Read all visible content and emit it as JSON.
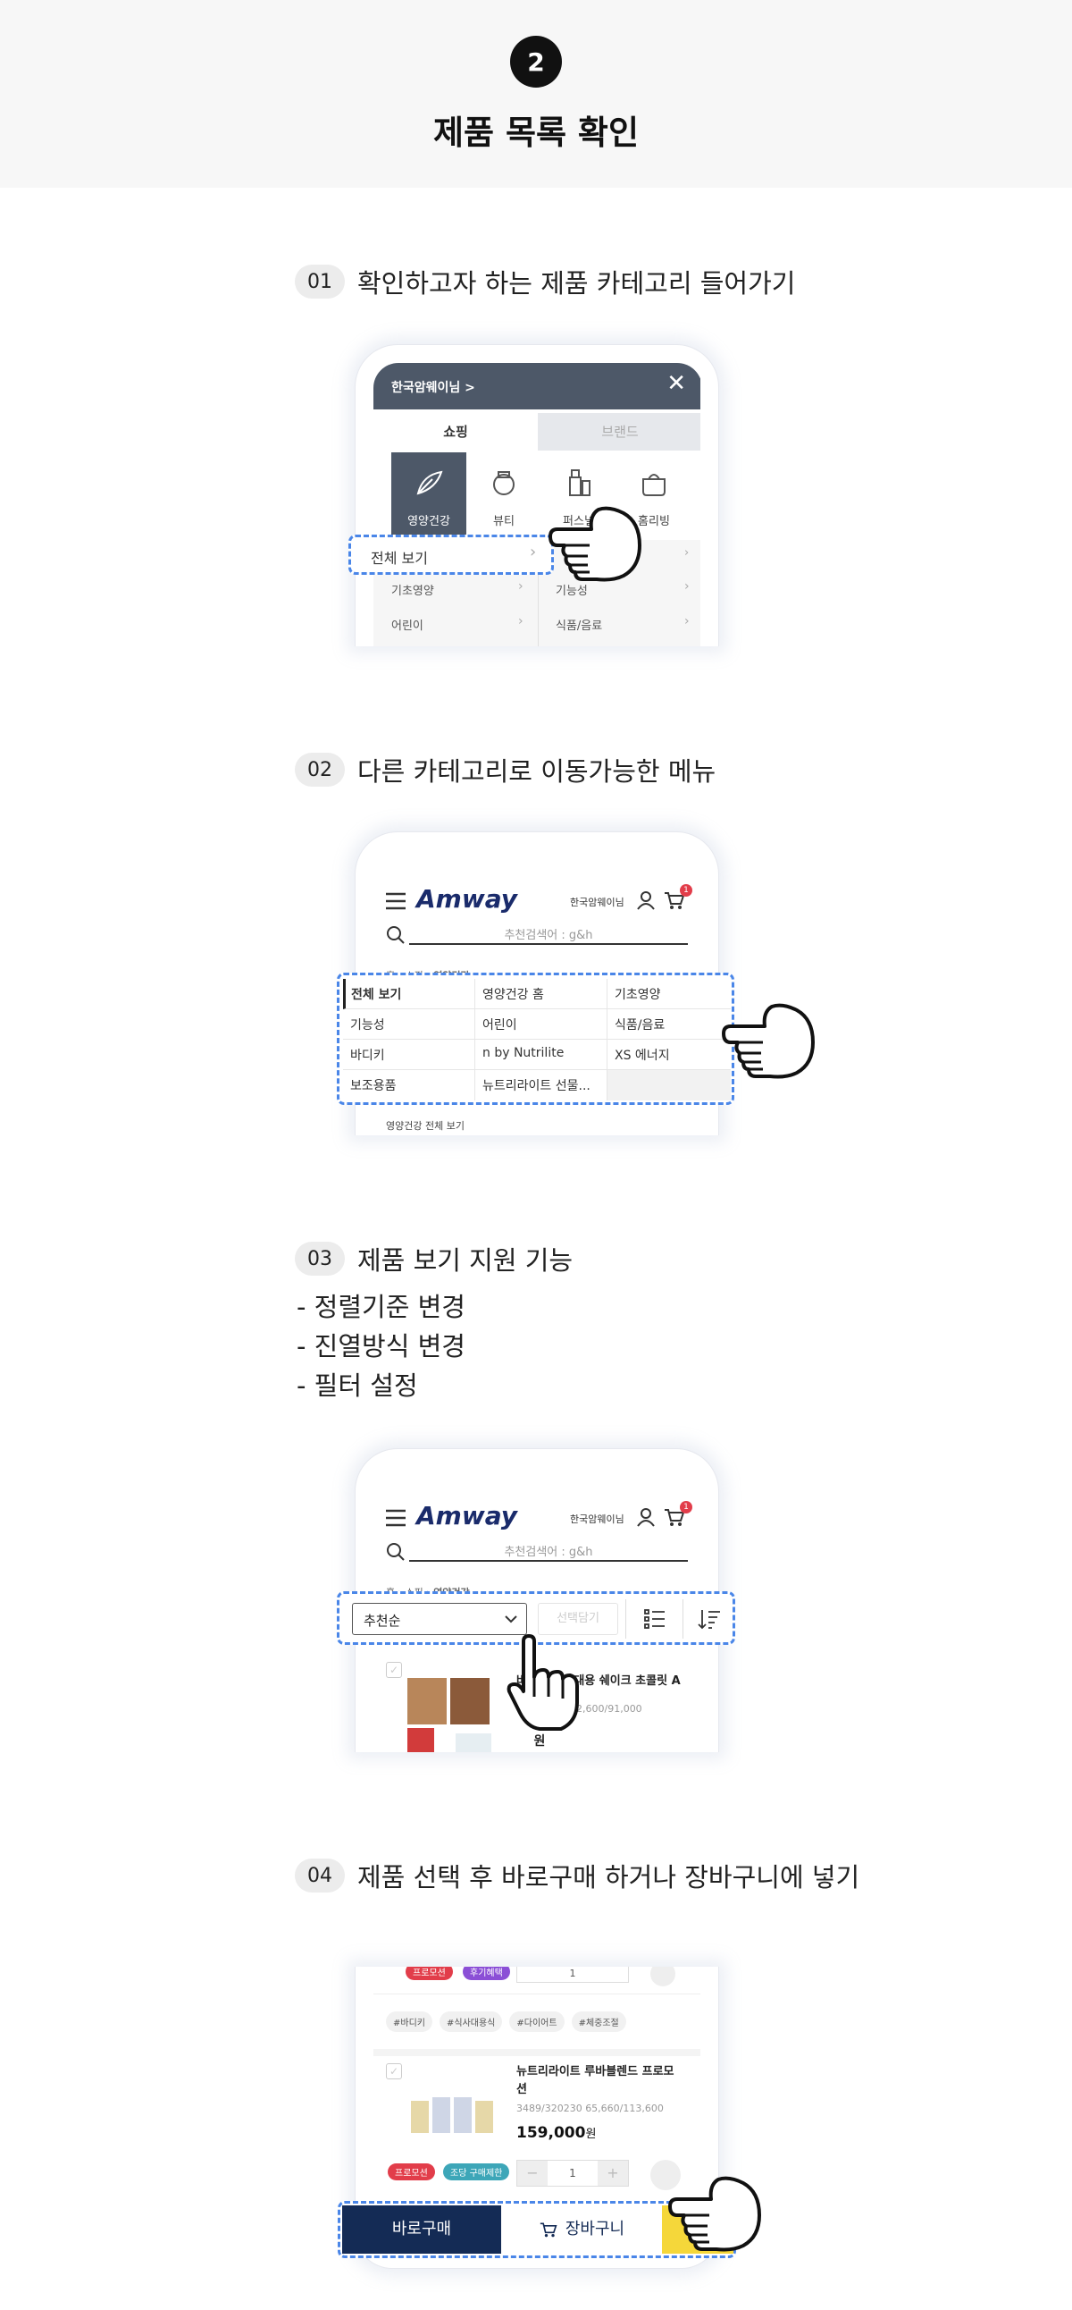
{
  "header": {
    "step": "2",
    "title": "제품 목록 확인"
  },
  "sections": [
    {
      "num": "01",
      "text": "확인하고자 하는 제품 카테고리 들어가기"
    },
    {
      "num": "02",
      "text": "다른 카테고리로 이동가능한 메뉴"
    },
    {
      "num": "03",
      "text": "제품 보기 지원 기능"
    },
    {
      "num": "04",
      "text": "제품 선택 후 바로구매 하거나 장바구니에 넣기"
    }
  ],
  "bullets": [
    "- 정렬기준 변경",
    "- 진열방식 변경",
    "- 필터 설정"
  ],
  "s1": {
    "user": "한국암웨이님 >",
    "tab_shopping": "쇼핑",
    "tab_brand": "브랜드",
    "cats": [
      "영양건강",
      "뷰티",
      "퍼스널",
      "홈리빙"
    ],
    "all_view": "전체 보기",
    "rows": [
      [
        "기초영양",
        "기능성"
      ],
      [
        "어린이",
        "식품/음료"
      ]
    ],
    "colors": {
      "header": "#4d5868",
      "tab_inactive": "#e6e8ec",
      "cat_active": "#4d5868"
    }
  },
  "s2": {
    "logo": "Amway",
    "user": "한국암웨이님",
    "cart_count": "1",
    "search_placeholder": "추천검색어 : g&h",
    "breadcrumb": [
      "홈",
      "쇼핑",
      "영양건강"
    ],
    "menu": [
      [
        "전체 보기",
        "영양건강 홈",
        "기초영양"
      ],
      [
        "기능성",
        "어린이",
        "식품/음료"
      ],
      [
        "바디키",
        "n by Nutrilite",
        "XS 에너지"
      ],
      [
        "보조용품",
        "뉴트리라이트 선물...",
        ""
      ]
    ],
    "peek": "영양건강 전체 보기"
  },
  "s3": {
    "logo": "Amway",
    "user": "한국암웨이님",
    "cart_count": "1",
    "search_placeholder": "추천검색어 : g&h",
    "breadcrumb": [
      "홈",
      "쇼핑",
      "영양건강"
    ],
    "sort": "추천순",
    "select_btn": "선택담기",
    "product_name": "바디키 식사대용 쉐이크 초콜릿 A",
    "product_code": "52,600/91,000",
    "price": "원"
  },
  "s4": {
    "badges_top": [
      "프로모션",
      "후기혜택"
    ],
    "qty": "1",
    "tags": [
      "#바디키",
      "#식사대용식",
      "#다이어트",
      "#체중조절"
    ],
    "product_name_1": "뉴트리라이트 루바블렌드 프로모",
    "product_name_2": "션",
    "product_code": "3489/320230 65,660/113,600",
    "price": "159,000",
    "price_unit": "원",
    "badges": [
      "프로모션",
      "조당 구매제한"
    ],
    "buy_now": "바로구매",
    "cart": "장바구니",
    "colors": {
      "buy": "#142b55",
      "badge_red": "#e23d4a",
      "badge_purple": "#8b4fd6",
      "badge_teal": "#3da6b8"
    }
  }
}
